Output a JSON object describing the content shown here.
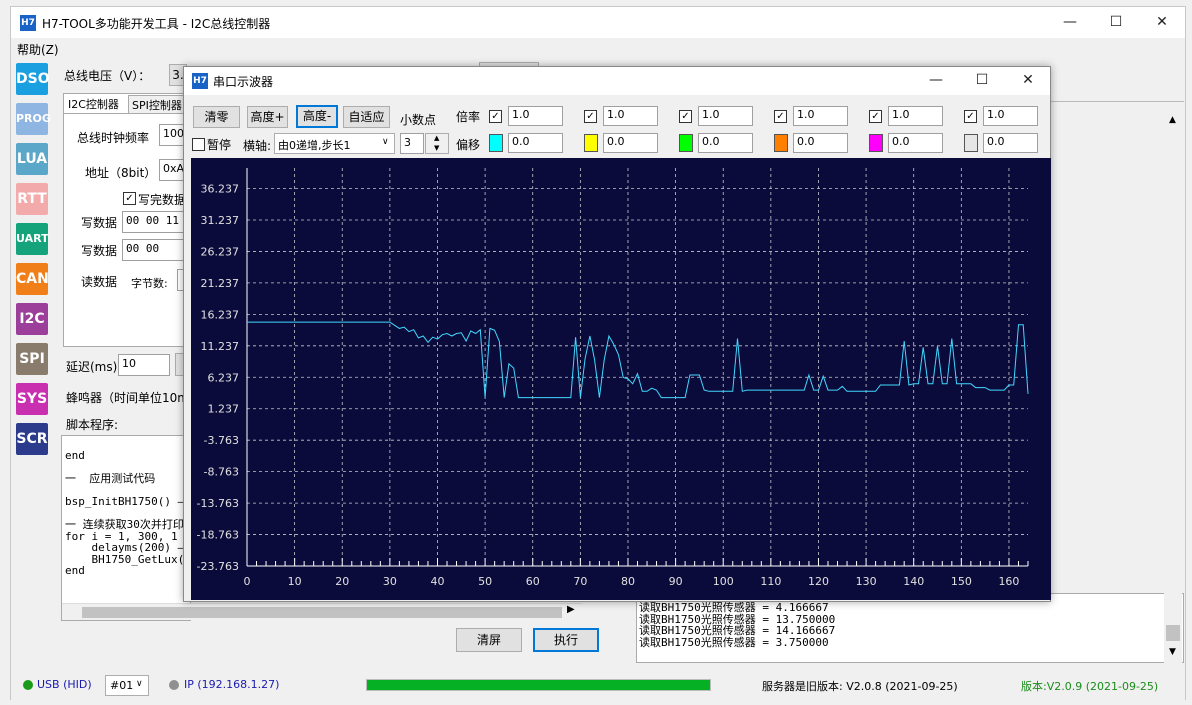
{
  "main": {
    "title": "H7-TOOL多功能开发工具 - I2C总线控制器",
    "logo": "H7",
    "menu": "帮助(Z)",
    "controls": {
      "minimize": "—",
      "maximize": "☐",
      "close": "✕"
    }
  },
  "nav": [
    {
      "label": "DSO",
      "color": "#1aa0e0"
    },
    {
      "label": "PROG",
      "color": "#8fb5e2"
    },
    {
      "label": "LUA",
      "color": "#5aa7c9"
    },
    {
      "label": "RTT",
      "color": "#f2aaaa"
    },
    {
      "label": "UART",
      "color": "#14a37a"
    },
    {
      "label": "CAN",
      "color": "#f07f1a"
    },
    {
      "label": "I2C",
      "color": "#9b3f9b"
    },
    {
      "label": "SPI",
      "color": "#8a7c6c"
    },
    {
      "label": "SYS",
      "color": "#c830b0"
    },
    {
      "label": "SCR",
      "color": "#2d3b8c"
    }
  ],
  "i2c": {
    "bus_voltage_label": "总线电压（V）：",
    "bus_voltage_value": "3.",
    "tab_i2c": "I2C控制器",
    "tab_spi": "SPI控制器",
    "clock_label": "总线时钟频率",
    "clock_value": "100",
    "addr_label": "地址（8bit）",
    "addr_value": "0xA(",
    "after_write_label": "写完数据",
    "write1_label": "写数据",
    "write1_value": "00 00 11 2",
    "write2_label": "写数据",
    "write2_value": "00 00",
    "read_label": "读数据",
    "bytes_label": "字节数:",
    "delay_label": "延迟(ms)",
    "delay_value": "10",
    "buzzer_label": "蜂鸣器（时间单位10ms",
    "script_label": "脚本程序:"
  },
  "script_lines": [
    "end",
    "",
    "一  应用测试代码",
    "",
    "bsp_InitBH1750() —",
    "",
    "一 连续获取30次并打印",
    "for i = 1, 300, 1 do",
    "    delayms(200) —",
    "    BH1750_GetLux();",
    "end"
  ],
  "buttons": {
    "clear_screen": "清屏",
    "execute": "执行"
  },
  "log_lines": [
    "读取BH1750光照传感器 = 4.166667",
    "读取BH1750光照传感器 = 13.750000",
    "读取BH1750光照传感器 = 14.166667",
    "读取BH1750光照传感器 = 3.750000"
  ],
  "scope": {
    "title": "串口示波器",
    "logo": "H7",
    "controls": {
      "minimize": "—",
      "maximize": "☐",
      "close": "✕"
    },
    "btn_clear": "清零",
    "btn_height_plus": "高度+",
    "btn_height_minus": "高度-",
    "btn_auto": "自适应",
    "decimal_label": "小数点",
    "decimal_value": "3",
    "pause_label": "暂停",
    "xaxis_label": "横轴:",
    "xaxis_value": "由0递增,步长1",
    "scale_label": "倍率",
    "offset_label": "偏移",
    "channels": [
      {
        "scale": "1.0",
        "offset": "0.0",
        "color": "#00ffff"
      },
      {
        "scale": "1.0",
        "offset": "0.0",
        "color": "#ffff00"
      },
      {
        "scale": "1.0",
        "offset": "0.0",
        "color": "#00ff00"
      },
      {
        "scale": "1.0",
        "offset": "0.0",
        "color": "#ff8000"
      },
      {
        "scale": "1.0",
        "offset": "0.0",
        "color": "#ff00ff"
      },
      {
        "scale": "1.0",
        "offset": "0.0",
        "color": "#e6e6e6"
      }
    ]
  },
  "chart_data": {
    "type": "line",
    "background": "#0b0b3b",
    "grid": true,
    "xlim": [
      0,
      164
    ],
    "ylim": [
      -23.763,
      39.5
    ],
    "x_ticks": [
      0,
      10,
      20,
      30,
      40,
      50,
      60,
      70,
      80,
      90,
      100,
      110,
      120,
      130,
      140,
      150,
      160
    ],
    "y_ticks": [
      "36.237",
      "31.237",
      "26.237",
      "21.237",
      "16.237",
      "11.237",
      "6.237",
      "1.237",
      "-3.763",
      "-8.763",
      "-13.763",
      "-18.763",
      "-23.763"
    ],
    "series": [
      {
        "color": "#40d8ff",
        "values": [
          15,
          15,
          15,
          15,
          15,
          15,
          15,
          15,
          15,
          15,
          15,
          15,
          15,
          15,
          15,
          15,
          15,
          15,
          15,
          15,
          15,
          15,
          15,
          15,
          15,
          15,
          15,
          15,
          15,
          15,
          15,
          14.5,
          14,
          14.2,
          13.5,
          13.8,
          12.5,
          12.8,
          11.8,
          12.6,
          12.3,
          13,
          13.2,
          12.8,
          13.2,
          13.3,
          12,
          13.6,
          13.2,
          13.8,
          3,
          14,
          13.7,
          11.9,
          3,
          8.4,
          7.7,
          3,
          3,
          3,
          3,
          3,
          3,
          3,
          3,
          3,
          3,
          3,
          3,
          12.6,
          3,
          9.2,
          12.8,
          9,
          3,
          9,
          12.8,
          11.5,
          9.8,
          6.2,
          6,
          5.2,
          6.8,
          4,
          4,
          4.5,
          4.2,
          3,
          3,
          3,
          3,
          3,
          3,
          6.6,
          6.6,
          6.6,
          4.2,
          4,
          4,
          4,
          4,
          4,
          4,
          12.4,
          4,
          4.2,
          4.2,
          4.2,
          4.2,
          4.2,
          4.2,
          4.2,
          4.2,
          4.2,
          4.2,
          4.2,
          4.2,
          4.2,
          6.6,
          4.2,
          4.2,
          6.4,
          4.2,
          4.2,
          4.2,
          4.8,
          4,
          4,
          4,
          4,
          4,
          4,
          4,
          5,
          5,
          5,
          5,
          5,
          12,
          5,
          5.2,
          5.2,
          11,
          5.2,
          5.2,
          11.2,
          5.2,
          5.2,
          12.4,
          5.2,
          5.2,
          5.2,
          5.2,
          4.6,
          4.6,
          4.6,
          4.2,
          4.2,
          4.2,
          4.2,
          5,
          5,
          14.6,
          14.6,
          3.6
        ]
      }
    ]
  },
  "status": {
    "usb_label": "USB (HID)",
    "usb_color": "#1a9b1a",
    "port_value": "#01",
    "ip_label": "IP (192.168.1.27)",
    "ip_color": "#909090",
    "progress": 1.0,
    "progress_color": "#06b025",
    "server_version": "服务器是旧版本: V2.0.8 (2021-09-25)",
    "local_version": "版本:V2.0.9 (2021-09-25)"
  }
}
